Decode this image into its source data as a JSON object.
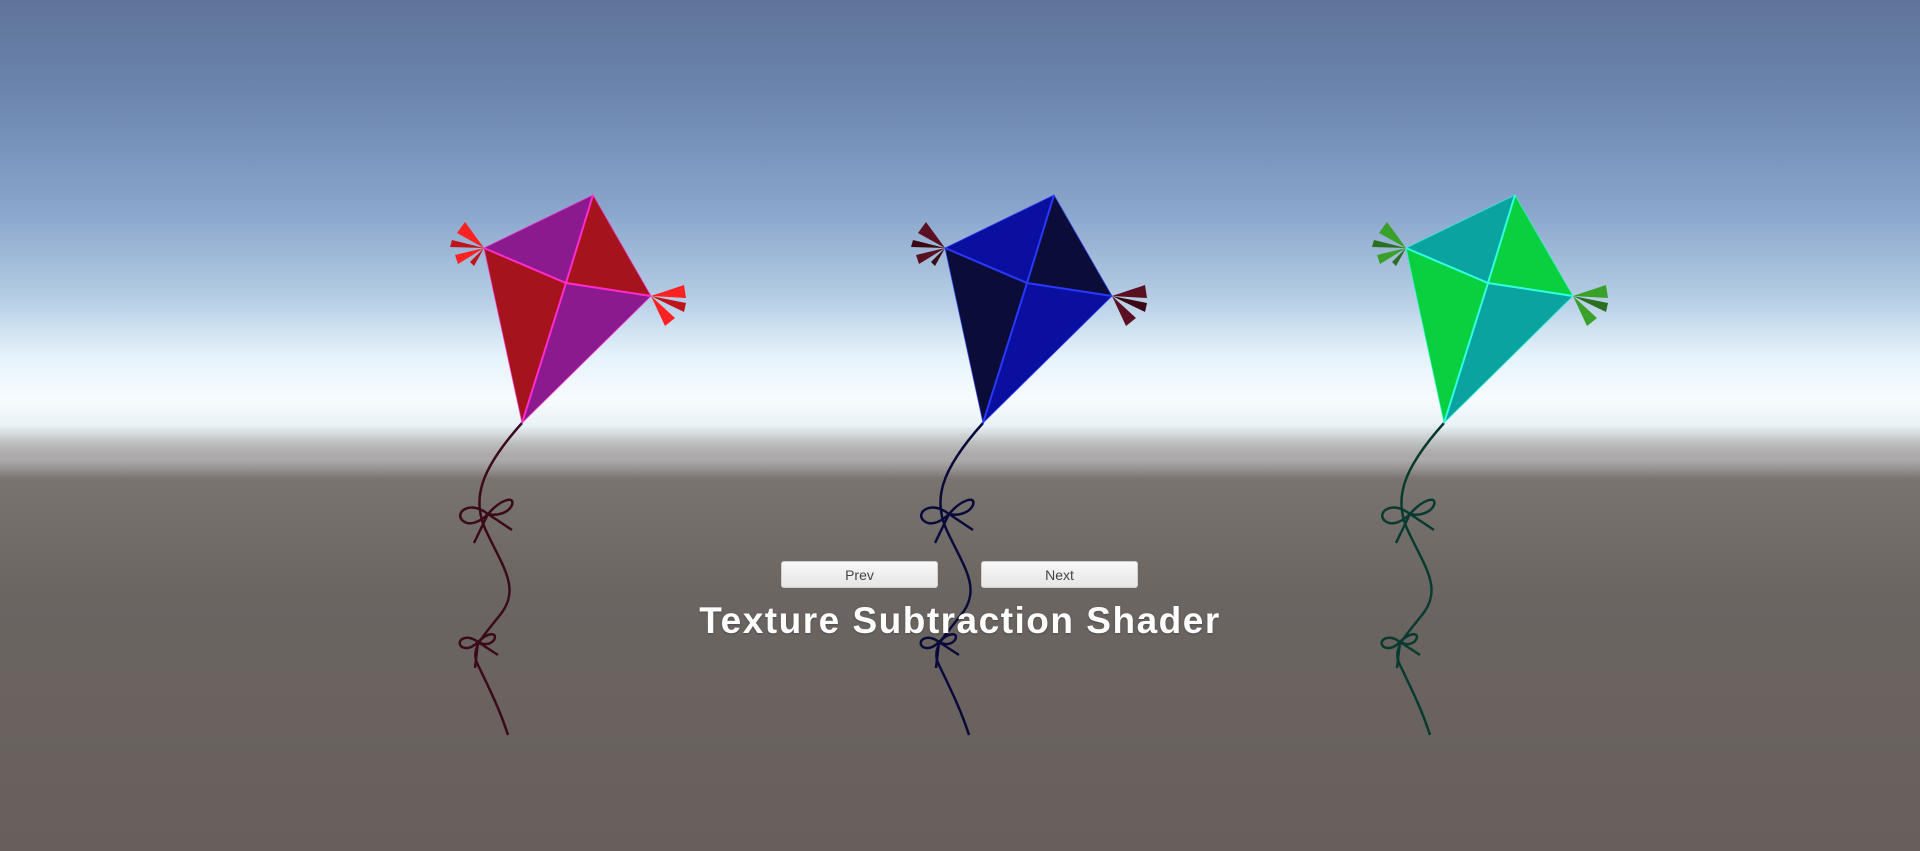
{
  "scene": {
    "kites": [
      {
        "name": "red-purple",
        "panel_a": "#8a1a8e",
        "panel_b": "#a5141c",
        "edge": "#ff2bd0",
        "tail": "#ff2222",
        "tail_dark": "#c0141c",
        "string": "#3a0a18"
      },
      {
        "name": "blue",
        "panel_a": "#0a0fa0",
        "panel_b": "#0b0d38",
        "edge": "#2a38ff",
        "tail": "#5a1020",
        "tail_dark": "#3a0a14",
        "string": "#0a0a3a"
      },
      {
        "name": "green-teal",
        "panel_a": "#0aa3a0",
        "panel_b": "#0ad040",
        "edge": "#30ffe0",
        "tail": "#3aa02a",
        "tail_dark": "#2a7020",
        "string": "#083a30"
      }
    ]
  },
  "ui": {
    "prev_label": "Prev",
    "next_label": "Next",
    "title": "Texture Subtraction Shader"
  }
}
